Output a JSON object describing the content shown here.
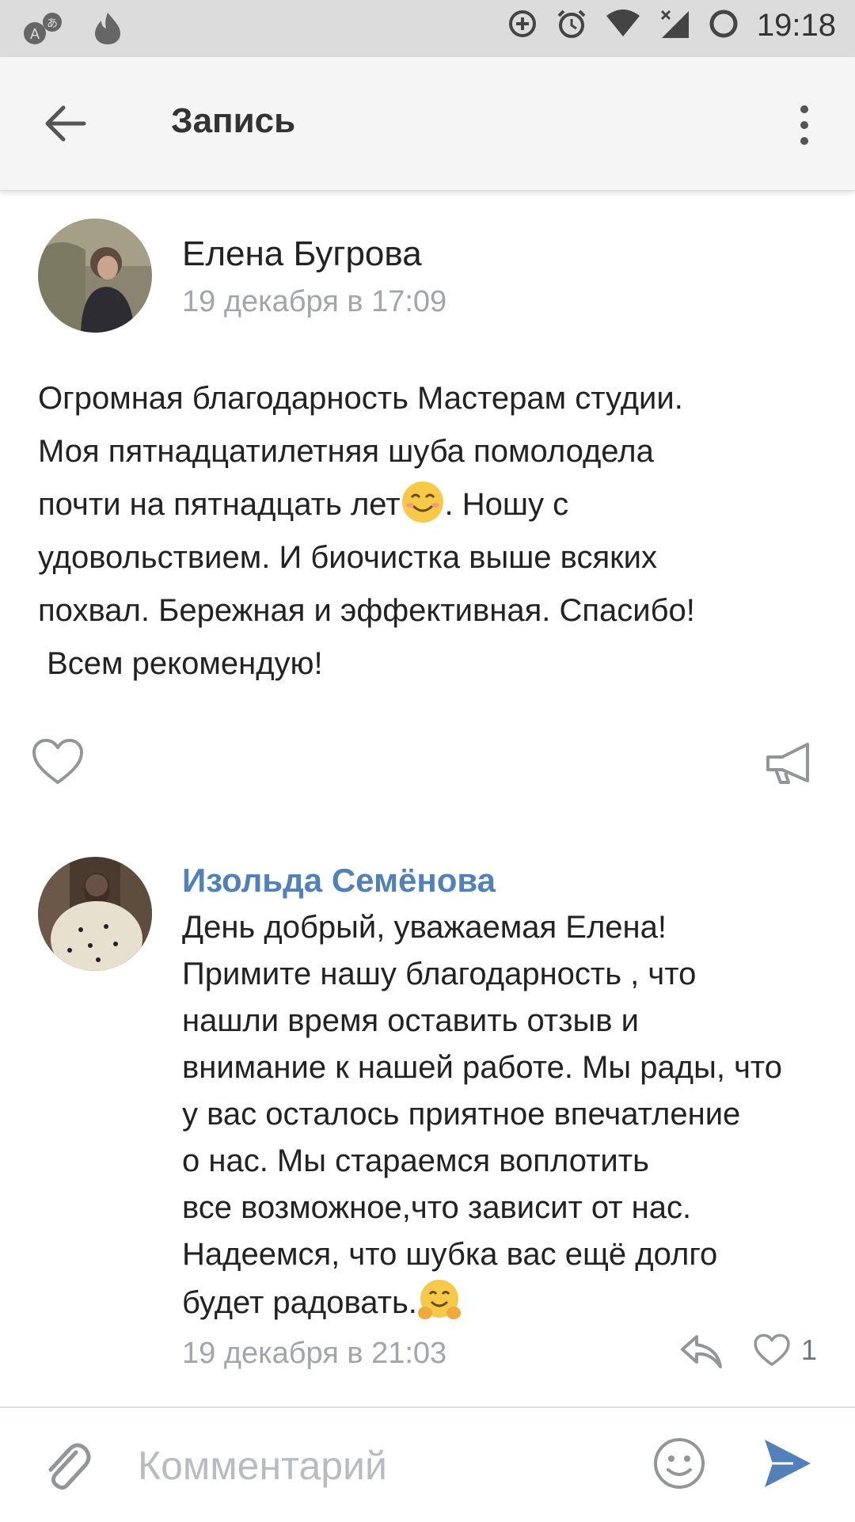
{
  "status_bar": {
    "time": "19:18",
    "left_icons": [
      "translate-icon",
      "fire-icon"
    ],
    "right_icons": [
      "data-saver-icon",
      "alarm-icon",
      "wifi-icon",
      "signal-icon",
      "battery-icon"
    ]
  },
  "appbar": {
    "title": "Запись",
    "back_icon": "arrow-left-icon",
    "menu_icon": "more-vertical-icon"
  },
  "post": {
    "author": "Елена Бугрова",
    "date": "19 декабря в 17:09",
    "text_part1": "Огромная благодарность Мастерам студии.\nМоя пятнадцатилетняя шуба помолодела\nпочти на пятнадцать лет",
    "emoji": "😊",
    "text_part2": ". Ношу с\nудовольствием. И биочистка выше всяких\nпохвал. Бережная и эффективная. Спасибо!\n Всем рекомендую!",
    "like_icon": "heart-outline-icon",
    "share_icon": "megaphone-icon"
  },
  "comment": {
    "author": "Изольда Семёнова",
    "text_part1": "День добрый, уважаемая Елена!\nПримите нашу благодарность , что\nнашли время оставить отзыв и\nвнимание к нашей работе. Мы рады, что\nу вас осталось приятное впечатление\nо нас. Мы стараемся воплотить\nвсе возможное,что зависит от нас.\nНадеемся, что шубка вас ещё долго\nбудет радовать.",
    "emoji": "🤗",
    "date": "19 декабря в 21:03",
    "likes": "1",
    "reply_icon": "reply-arrow-icon",
    "like_icon": "heart-outline-icon"
  },
  "composer": {
    "placeholder": "Комментарий",
    "attach_icon": "paperclip-icon",
    "emoji_icon": "smiley-icon",
    "send_icon": "send-icon",
    "send_color": "#5181b8"
  },
  "colors": {
    "link_blue": "#5181b8",
    "secondary_text": "#a2a5aa",
    "icon_gray": "#939699"
  }
}
